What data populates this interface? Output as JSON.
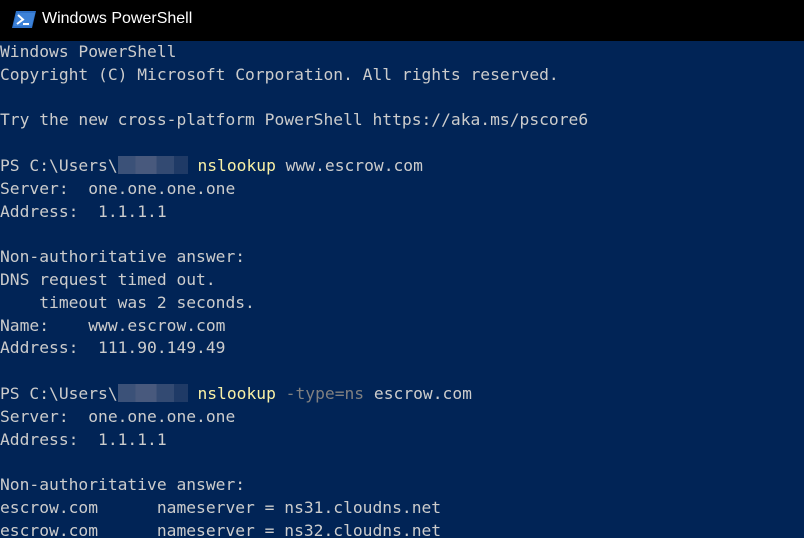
{
  "window": {
    "title": "Windows PowerShell",
    "icon": "powershell-icon",
    "colors": {
      "background": "#012456",
      "text": "#cccccc",
      "command": "#f9f1a5",
      "parameter": "#808080",
      "titlebar": "#000000"
    }
  },
  "console": {
    "lines": [
      {
        "type": "text",
        "text": "Windows PowerShell"
      },
      {
        "type": "text",
        "text": "Copyright (C) Microsoft Corporation. All rights reserved."
      },
      {
        "type": "blank",
        "text": ""
      },
      {
        "type": "text",
        "text": "Try the new cross-platform PowerShell https://aka.ms/pscore6"
      },
      {
        "type": "blank",
        "text": ""
      },
      {
        "type": "prompt",
        "prompt": "PS C:\\Users\\",
        "redacted": true,
        "command": "nslookup",
        "param": "",
        "args": " www.escrow.com"
      },
      {
        "type": "text",
        "text": "Server:  one.one.one.one"
      },
      {
        "type": "text",
        "text": "Address:  1.1.1.1"
      },
      {
        "type": "blank",
        "text": ""
      },
      {
        "type": "text",
        "text": "Non-authoritative answer:"
      },
      {
        "type": "text",
        "text": "DNS request timed out."
      },
      {
        "type": "text",
        "text": "    timeout was 2 seconds."
      },
      {
        "type": "text",
        "text": "Name:    www.escrow.com"
      },
      {
        "type": "text",
        "text": "Address:  111.90.149.49"
      },
      {
        "type": "blank",
        "text": ""
      },
      {
        "type": "prompt",
        "prompt": "PS C:\\Users\\",
        "redacted": true,
        "command": "nslookup",
        "param": " -type=ns",
        "args": " escrow.com"
      },
      {
        "type": "text",
        "text": "Server:  one.one.one.one"
      },
      {
        "type": "text",
        "text": "Address:  1.1.1.1"
      },
      {
        "type": "blank",
        "text": ""
      },
      {
        "type": "text",
        "text": "Non-authoritative answer:"
      },
      {
        "type": "text",
        "text": "escrow.com      nameserver = ns31.cloudns.net"
      },
      {
        "type": "text",
        "text": "escrow.com      nameserver = ns32.cloudns.net"
      }
    ]
  }
}
